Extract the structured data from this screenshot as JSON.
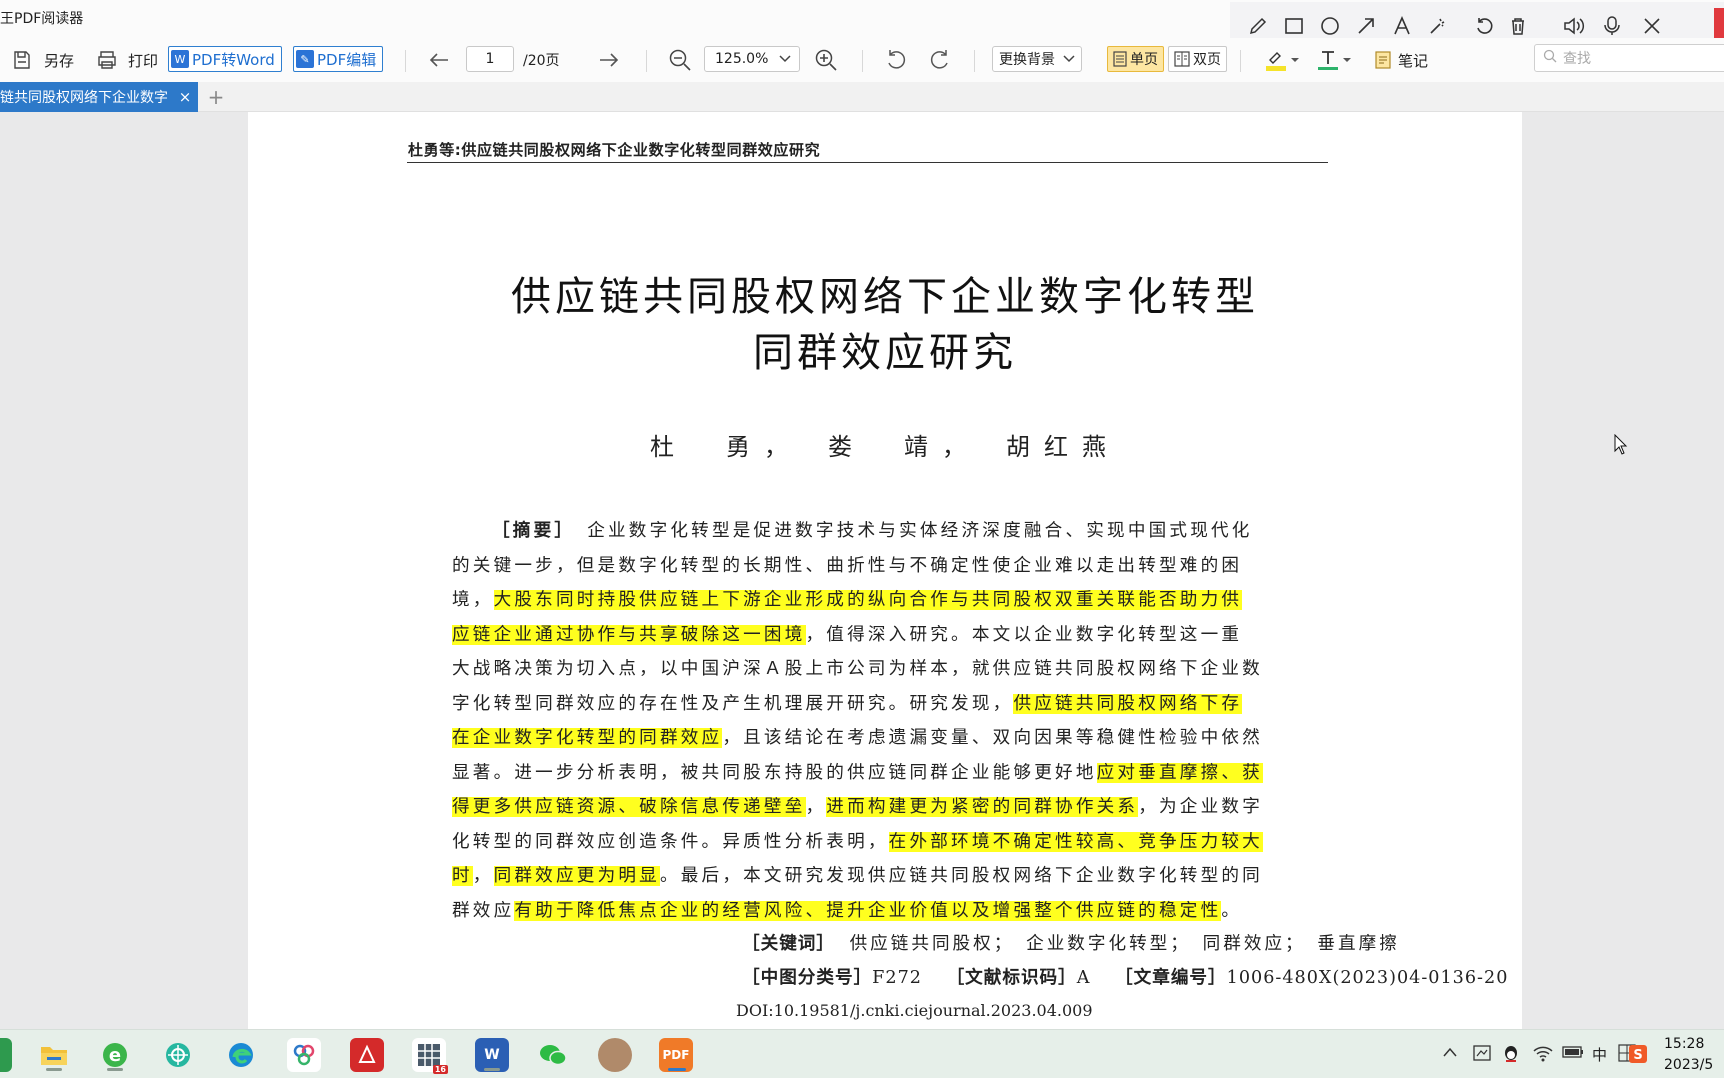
{
  "app": {
    "title": "王PDF阅读器"
  },
  "toolbar": {
    "save_as": "另存",
    "print": "打印",
    "pdf_to_word": "PDF转Word",
    "pdf_edit": "PDF编辑",
    "page_current": "1",
    "page_total": "/20页",
    "zoom": "125.0%",
    "background": "更换背景",
    "single_page": "单页",
    "double_page": "双页",
    "notes": "笔记",
    "search_placeholder": "查找"
  },
  "annotation_tools": [
    "pencil-icon",
    "rectangle-icon",
    "circle-icon",
    "arrow-icon",
    "text-icon",
    "magic-wand-icon",
    "undo-icon",
    "trash-icon",
    "speaker-icon",
    "microphone-icon",
    "close-icon"
  ],
  "tab": {
    "label": "链共同股权网络下企业数字",
    "close": "×",
    "add": "+"
  },
  "document": {
    "running_head": "杜勇等:供应链共同股权网络下企业数字化转型同群效应研究",
    "title_line1": "供应链共同股权网络下企业数字化转型",
    "title_line2": "同群效应研究",
    "authors": "杜　勇，　娄　靖，　胡红燕",
    "abstract_label": "［摘要］",
    "abstract_lines": [
      [
        {
          "t": "企业数字化转型是促进数字技术与实体经济深度融合、实现中国式现代化",
          "h": false
        }
      ],
      [
        {
          "t": "的关键一步，但是数字化转型的长期性、曲折性与不确定性使企业难以走出转型难的困",
          "h": false
        }
      ],
      [
        {
          "t": "境，",
          "h": false
        },
        {
          "t": "大股东同时持股供应链上下游企业形成的纵向合作与共同股权双重关联能否助力供",
          "h": true
        }
      ],
      [
        {
          "t": "应链企业通过协作与共享破除这一困境",
          "h": true
        },
        {
          "t": "，值得深入研究。本文以企业数字化转型这一重",
          "h": false
        }
      ],
      [
        {
          "t": "大战略决策为切入点，以中国沪深Ａ股上市公司为样本，就供应链共同股权网络下企业数",
          "h": false
        }
      ],
      [
        {
          "t": "字化转型同群效应的存在性及产生机理展开研究。研究发现，",
          "h": false
        },
        {
          "t": "供应链共同股权网络下存",
          "h": true
        }
      ],
      [
        {
          "t": "在企业数字化转型的同群效应",
          "h": true
        },
        {
          "t": "，且该结论在考虑遗漏变量、双向因果等稳健性检验中依然",
          "h": false
        }
      ],
      [
        {
          "t": "显著。进一步分析表明，被共同股东持股的供应链同群企业能够更好地",
          "h": false
        },
        {
          "t": "应对垂直摩擦、获",
          "h": true
        }
      ],
      [
        {
          "t": "得更多供应链资源、破除信息传递壁垒",
          "h": true
        },
        {
          "t": "，",
          "h": false
        },
        {
          "t": "进而构建更为紧密的同群协作关系",
          "h": true
        },
        {
          "t": "，为企业数字",
          "h": false
        }
      ],
      [
        {
          "t": "化转型的同群效应创造条件。异质性分析表明，",
          "h": false
        },
        {
          "t": "在外部环境不确定性较高、竞争压力较大",
          "h": true
        }
      ],
      [
        {
          "t": "时",
          "h": true
        },
        {
          "t": "，",
          "h": false
        },
        {
          "t": "同群效应更为明显",
          "h": true
        },
        {
          "t": "。最后，本文研究发现供应链共同股权网络下企业数字化转型的同",
          "h": false
        }
      ],
      [
        {
          "t": "群效应",
          "h": false
        },
        {
          "t": "有助于降低焦点企业的经营风险、提升企业价值以及增强整个供应链的稳定性",
          "h": true
        },
        {
          "t": "。",
          "h": false
        }
      ]
    ],
    "keywords_label": "［关键词］",
    "keywords": "供应链共同股权；　企业数字化转型；　同群效应；　垂直摩擦",
    "clc_label": "［中图分类号］",
    "clc": "F272",
    "doc_code_label": "［文献标识码］",
    "doc_code": "A",
    "article_no_label": "［文章编号］",
    "article_no": "1006-480X(2023)04-0136-20",
    "doi": "DOI:10.19581/j.cnki.ciejournal.2023.04.009"
  },
  "taskbar": {
    "time": "15:28",
    "date": "2023/5",
    "ime": "中",
    "badge": "16"
  },
  "colors": {
    "highlight": "#ffff1f",
    "tab_active": "#2d79c9",
    "accent_blue": "#1f6fd0"
  }
}
